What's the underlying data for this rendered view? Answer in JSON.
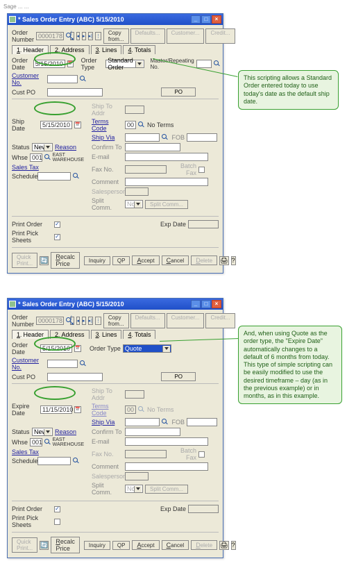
{
  "truncated_top": "Sage ... ...",
  "window_title": "* Sales Order Entry (ABC) 5/15/2010",
  "top_buttons": {
    "copy": "Copy from...",
    "defaults": "Defaults...",
    "customer": "Customer...",
    "credit": "Credit..."
  },
  "order_number": {
    "label": "Order Number",
    "value": "0000178"
  },
  "tabs": {
    "header": "Header",
    "address": "Address",
    "lines": "Lines",
    "totals": "Totals",
    "hk_header": "1",
    "hk_address": "2",
    "hk_lines": "3",
    "hk_totals": "4"
  },
  "row_order": {
    "date_label": "Order Date",
    "date_value": "5/15/2010",
    "type_label": "Order Type",
    "type_value": "Standard Order",
    "quote_value": "Quote",
    "mr_label": "Master/Repeating No."
  },
  "customer_no": "Customer No.",
  "cust_po": "Cust PO",
  "po_btn": "PO",
  "right": {
    "shipto": "Ship To Addr",
    "terms": "Terms Code",
    "terms_val": "00",
    "terms_desc": "No Terms",
    "shipvia": "Ship Via",
    "fob": "FOB",
    "confirm": "Confirm To",
    "email": "E-mail",
    "faxno": "Fax No.",
    "batchfax": "Batch Fax",
    "comment": "Comment",
    "salesperson": "Salesperson",
    "splitcomm": "Split Comm.",
    "splitno": "No",
    "splitbtn": "Split Comm..."
  },
  "ship_date": {
    "label": "Ship Date",
    "value": "5/15/2010"
  },
  "expire_date_row": {
    "label": "Expire Date",
    "value": "11/15/2010"
  },
  "status": {
    "label": "Status",
    "value": "New",
    "reason": "Reason"
  },
  "whse": {
    "label": "Whse",
    "code": "001",
    "name": "EAST WAREHOUSE"
  },
  "salestax": "Sales Tax",
  "schedule": "Schedule",
  "printorder": "Print Order",
  "printpicksheets": "Print Pick Sheets",
  "expdate": "Exp Date",
  "bottom": {
    "quickprint": "Quick Print...",
    "recalc": "Recalc Price",
    "inquiry": "Inquiry",
    "qp": "QP",
    "accept": "Accept",
    "cancel": "Cancel",
    "delete": "Delete",
    "hk_accept": "A",
    "hk_cancel": "C",
    "hk_delete": "D",
    "hk_recalc": "R"
  },
  "callout1": "This scripting allows a Standard Order entered today to use today's date as the default ship date.",
  "callout2": "And, when using Quote as the order type, the \"Expire Date\" automatically changes to a default of 6 months from today. This type of simple scripting can be easily modified to use the desired timeframe – day (as in the previous example) or in months, as in this example."
}
